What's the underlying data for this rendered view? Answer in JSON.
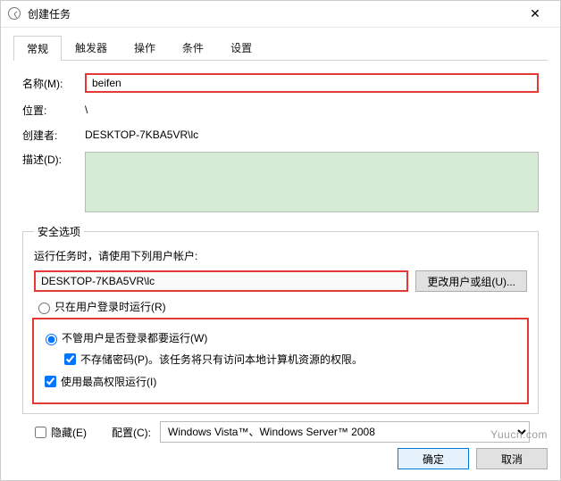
{
  "window": {
    "title": "创建任务",
    "close": "✕"
  },
  "tabs": {
    "items": [
      "常规",
      "触发器",
      "操作",
      "条件",
      "设置"
    ],
    "active": 0
  },
  "general": {
    "name_label": "名称(M):",
    "name_value": "beifen",
    "location_label": "位置:",
    "location_value": "\\",
    "creator_label": "创建者:",
    "creator_value": "DESKTOP-7KBA5VR\\lc",
    "desc_label": "描述(D):",
    "desc_value": ""
  },
  "security": {
    "legend": "安全选项",
    "prompt": "运行任务时，请使用下列用户帐户:",
    "account": "DESKTOP-7KBA5VR\\lc",
    "change_btn": "更改用户或组(U)...",
    "radio_logged": "只在用户登录时运行(R)",
    "radio_always": "不管用户是否登录都要运行(W)",
    "no_store_pw": "不存储密码(P)。该任务将只有访问本地计算机资源的权限。",
    "highest_priv": "使用最高权限运行(I)",
    "radio_always_checked": true,
    "no_store_pw_checked": true,
    "highest_priv_checked": true
  },
  "bottom": {
    "hidden_label": "隐藏(E)",
    "hidden_checked": false,
    "config_label": "配置(C):",
    "config_value": "Windows Vista™、Windows Server™ 2008"
  },
  "buttons": {
    "ok": "确定",
    "cancel": "取消"
  },
  "watermark": "Yuucn.com"
}
